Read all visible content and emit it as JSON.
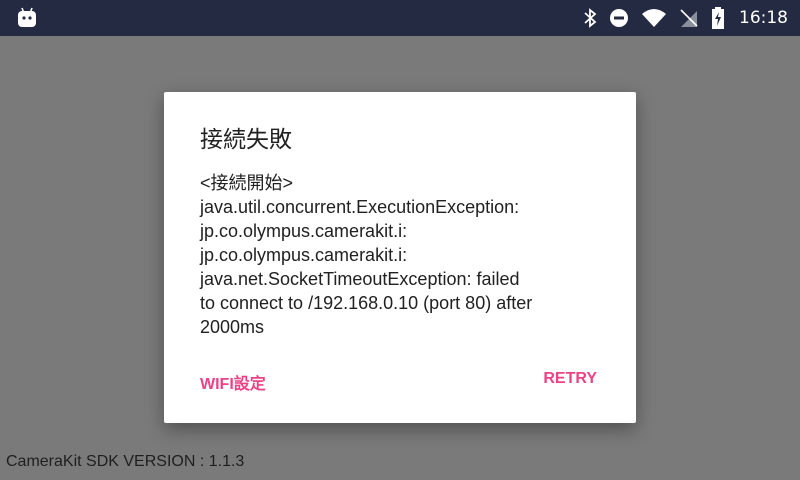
{
  "status_bar": {
    "time": "16:18",
    "icons": [
      "android-notification-icon",
      "bluetooth-icon",
      "do-not-disturb-icon",
      "wifi-icon",
      "no-sim-icon",
      "battery-charging-icon"
    ]
  },
  "dialog": {
    "title": "接続失敗",
    "message_lines": [
      "<接続開始>",
      "java.util.concurrent.ExecutionException:",
      "jp.co.olympus.camerakit.i:",
      "jp.co.olympus.camerakit.i:",
      "java.net.SocketTimeoutException: failed",
      "to connect to /192.168.0.10 (port 80) after",
      "2000ms"
    ],
    "buttons": {
      "wifi_settings": "WIFI設定",
      "retry": "RETRY"
    },
    "accent_color": "#ee4287"
  },
  "footer": {
    "version_text": "CameraKit SDK VERSION : 1.1.3"
  }
}
